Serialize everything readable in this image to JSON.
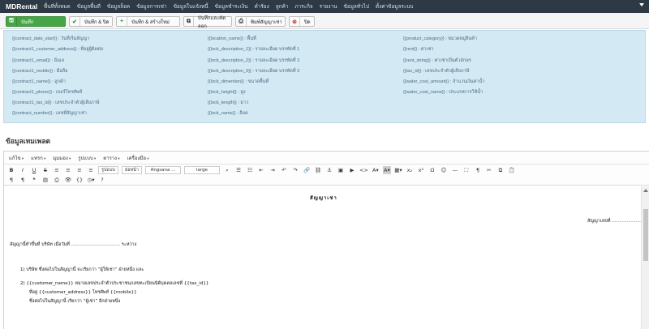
{
  "nav": {
    "brand": "MDRental",
    "menu": [
      "พื้นที่ทั้งหมด",
      "ข้อมูลพื้นที่",
      "ข้อมูลล็อค",
      "ข้อมูลการเช่า",
      "ข้อมูลใบแจ้งหนี้",
      "ข้อมูลชำระเงิน",
      "คำร้อง",
      "ลูกค้า",
      "ภาระกิจ",
      "รายงาน",
      "ข้อมูลทั่วไป",
      "ตั้งค่าข้อมูลระบบ"
    ]
  },
  "toolbar": {
    "save": "บันทึก",
    "save_close": "บันทึก & ปิด",
    "save_new": "บันทึก & สร้างใหม่",
    "save_copy": "บันทึกและคัดลอก",
    "print": "พิมพ์สัญญาเช่า",
    "close": "ปิด"
  },
  "placeholders": {
    "col1": [
      "{{contract_date_start}} : วันที่เริ่มสัญญา",
      "{{contract1_customer_address}} : ที่อยู่ผู้ติดต่อ",
      "{{contract1_email}} : อีเมล",
      "{{contract1_mobile}} : มือถือ",
      "{{contract1_name}} : ลูกค้า",
      "{{contract1_phone}} : เบอร์โทรศัพท์",
      "{{contract1_tax_id}} : เลขประจำตัวผู้เสียภาษี",
      "{{contract_number}} : เลขที่สัญญาเช่า"
    ],
    "col2": [
      "{{location_name}} : พื้นที่",
      "{{lock_description_1}} : รายละเอียด บรรทัดที่ 1",
      "{{lock_description_2}} : รายละเอียด บรรทัดที่ 2",
      "{{lock_description_3}} : รายละเอียด บรรทัดที่ 3",
      "{{lock_dimention}} : ขนาดพื้นที่",
      "{{lock_height}} : สูง",
      "{{lock_length}} : ยาว",
      "{{lock_name}} : ล็อค"
    ],
    "col3": [
      "{{product_category}} : หมวดหมู่สินค้า",
      "{{rent}} : ค่าเช่า",
      "{{rent_string}} : ค่าเช่าเป็นตัวอักษร",
      "{{tax_id}} : เลขประจำตัวผู้เสียภาษี",
      "{{water_cost_amount}} : จำนวนเงินค่าน้ำ",
      "{{water_cost_name}} : ประเภทการใช้น้ำ"
    ]
  },
  "section_heading": "ข้อมูลเทมเพลต",
  "editor": {
    "menubar": [
      "แก้ไข",
      "แทรก",
      "มุมมอง",
      "รูปแบบ",
      "ตาราง",
      "เครื่องมือ"
    ],
    "format_select": "รูปแบบ",
    "block_select": "ย่อหน้า",
    "font_select": "Angsana ...",
    "size_select": "large",
    "icons": {
      "bold": "B",
      "italic": "I",
      "underline": "U",
      "strike": "S",
      "align_left": "⯇",
      "undo": "↶",
      "redo": "↷",
      "subscript": "x₂",
      "superscript": "x²",
      "omega": "Ω",
      "emoji": "☺",
      "fullscreen": "⛶",
      "pilcrow": "¶",
      "source": "<>",
      "print": "⎙",
      "help": "?"
    },
    "content": {
      "title": "สัญญาเช่า",
      "contract_no": "สัญญาเลขที่ ……………………",
      "made_at": "สัญญานี้ทำขึ้นที่ บริษัท เมื่อวันที่ …………………………… ระหว่าง",
      "party1": "1) บริษัท ซึ่งต่อไปในสัญญานี้ จะเรียกว่า “ผู้ให้เช่า” ฝ่ายหนึ่ง และ",
      "party2": "2) {{customer_name}} หมายเลขประจำตัวประชาชน/เลขทะเบียนนิติบุคคลเลขที่ {{tax_id}}",
      "address": "ที่อยู่ {{customer_address}} โทรศัพท์ {{mobile}}",
      "lessee": "ซึ่งต่อไปในสัญญานี้ เรียกว่า “ผู้เช่า” อีกฝ่ายหนึ่ง"
    }
  }
}
